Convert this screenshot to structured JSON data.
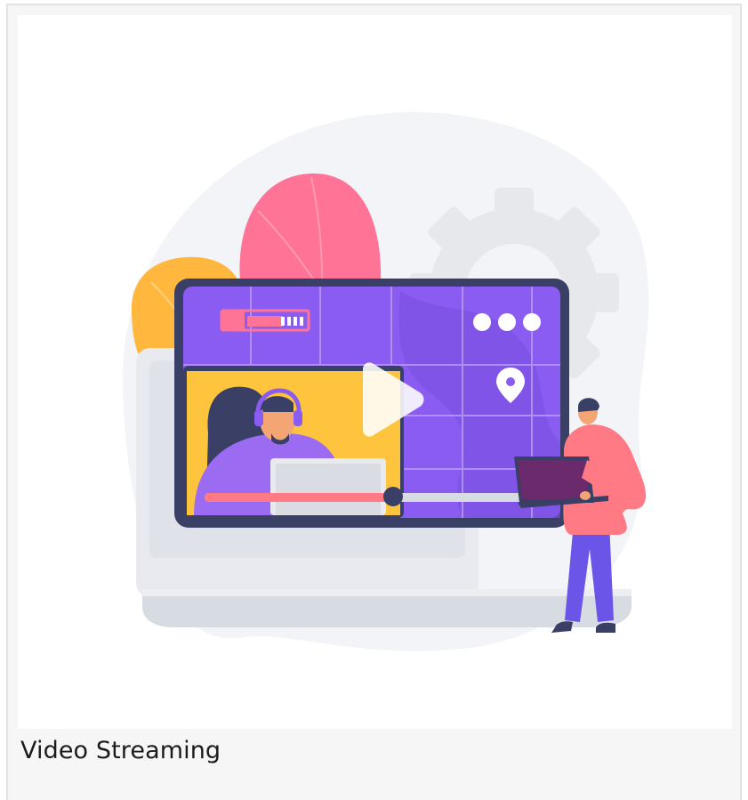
{
  "card": {
    "caption": "Video Streaming"
  },
  "illustration": {
    "subject": "video-streaming",
    "colors": {
      "screen_purple": "#8b5cf0",
      "screen_frame": "#3a3f66",
      "inset_yellow": "#ffc43d",
      "blob_pink": "#ff6f91",
      "blob_orange": "#ffb13b",
      "person_shirt": "#ff7a85",
      "person_pants": "#6b54e8",
      "gear_gray": "#e9ebee",
      "background_blob": "#f2f4f7"
    },
    "icons": [
      "play-icon",
      "location-pin-icon",
      "more-dots-icon",
      "gear-icon",
      "laptop-icon",
      "headset-icon"
    ]
  }
}
